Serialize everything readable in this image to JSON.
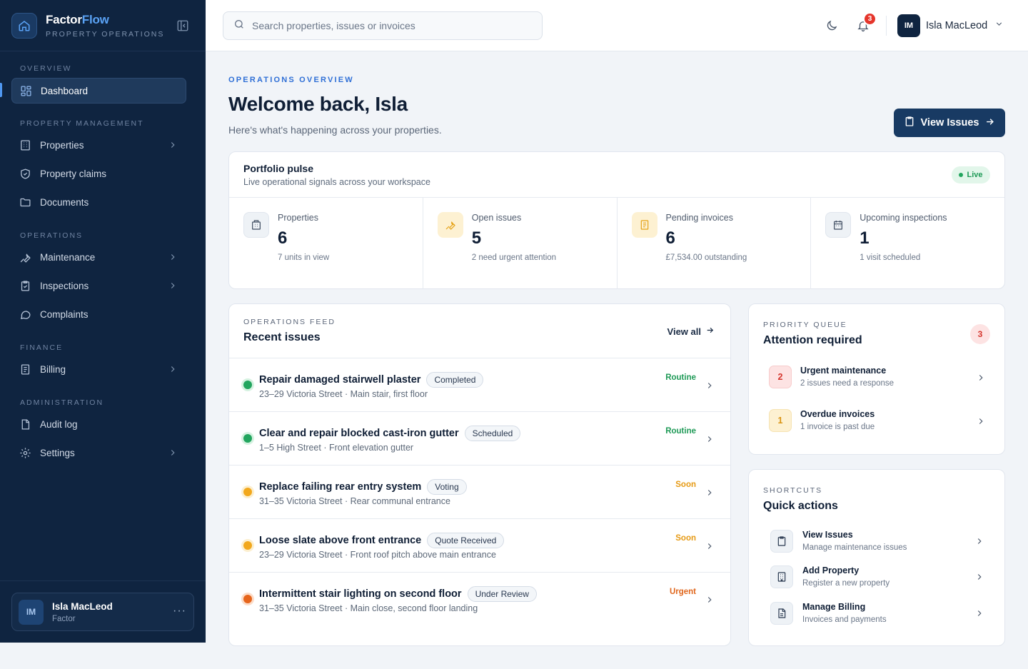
{
  "brand": {
    "name_main": "Factor",
    "name_accent": "Flow",
    "subtitle": "PROPERTY OPERATIONS"
  },
  "sidebar": {
    "sections": {
      "overview": "OVERVIEW",
      "property_management": "PROPERTY MANAGEMENT",
      "operations": "OPERATIONS",
      "finance": "FINANCE",
      "administration": "ADMINISTRATION"
    },
    "items": {
      "dashboard": "Dashboard",
      "properties": "Properties",
      "property_claims": "Property claims",
      "documents": "Documents",
      "maintenance": "Maintenance",
      "inspections": "Inspections",
      "complaints": "Complaints",
      "billing": "Billing",
      "audit_log": "Audit log",
      "settings": "Settings"
    },
    "user": {
      "initials": "IM",
      "name": "Isla MacLeod",
      "role": "Factor"
    }
  },
  "topbar": {
    "search_placeholder": "Search properties, issues or invoices",
    "notification_count": "3",
    "user_initials": "IM",
    "user_name": "Isla MacLeod"
  },
  "header": {
    "eyebrow": "OPERATIONS OVERVIEW",
    "title": "Welcome back, Isla",
    "subtitle": "Here's what's happening across your properties.",
    "primary_button": "View Issues"
  },
  "pulse": {
    "title": "Portfolio pulse",
    "subtitle": "Live operational signals across your workspace",
    "live_label": "Live",
    "stats": [
      {
        "label": "Properties",
        "value": "6",
        "sub": "7 units in view"
      },
      {
        "label": "Open issues",
        "value": "5",
        "sub": "2 need urgent attention"
      },
      {
        "label": "Pending invoices",
        "value": "6",
        "sub": "£7,534.00 outstanding"
      },
      {
        "label": "Upcoming inspections",
        "value": "1",
        "sub": "1 visit scheduled"
      }
    ]
  },
  "feed": {
    "eyebrow": "OPERATIONS FEED",
    "title": "Recent issues",
    "view_all": "View all",
    "issues": [
      {
        "title": "Repair damaged stairwell plaster",
        "status": "Completed",
        "location": "23–29 Victoria Street · Main stair, first floor",
        "priority": "Routine",
        "color": "#1f9a57"
      },
      {
        "title": "Clear and repair blocked cast-iron gutter",
        "status": "Scheduled",
        "location": "1–5 High Street · Front elevation gutter",
        "priority": "Routine",
        "color": "#1f9a57"
      },
      {
        "title": "Replace failing rear entry system",
        "status": "Voting",
        "location": "31–35 Victoria Street · Rear communal entrance",
        "priority": "Soon",
        "color": "#e69a14"
      },
      {
        "title": "Loose slate above front entrance",
        "status": "Quote Received",
        "location": "23–29 Victoria Street · Front roof pitch above main entrance",
        "priority": "Soon",
        "color": "#e69a14"
      },
      {
        "title": "Intermittent stair lighting on second floor",
        "status": "Under Review",
        "location": "31–35 Victoria Street · Main close, second floor landing",
        "priority": "Urgent",
        "color": "#e0661c"
      }
    ]
  },
  "queue": {
    "eyebrow": "PRIORITY QUEUE",
    "title": "Attention required",
    "count": "3",
    "items": [
      {
        "count": "2",
        "title": "Urgent maintenance",
        "sub": "2 issues need a response"
      },
      {
        "count": "1",
        "title": "Overdue invoices",
        "sub": "1 invoice is past due"
      }
    ]
  },
  "shortcuts": {
    "eyebrow": "SHORTCUTS",
    "title": "Quick actions",
    "items": [
      {
        "title": "View Issues",
        "sub": "Manage maintenance issues",
        "icon": "clipboard-icon"
      },
      {
        "title": "Add Property",
        "sub": "Register a new property",
        "icon": "building-icon"
      },
      {
        "title": "Manage Billing",
        "sub": "Invoices and payments",
        "icon": "document-icon"
      }
    ]
  },
  "colors": {
    "accent": "#2f6fd6",
    "sidebar": "#0f2440",
    "routine": "#1f9a57",
    "soon": "#e69a14",
    "urgent": "#e0661c"
  }
}
